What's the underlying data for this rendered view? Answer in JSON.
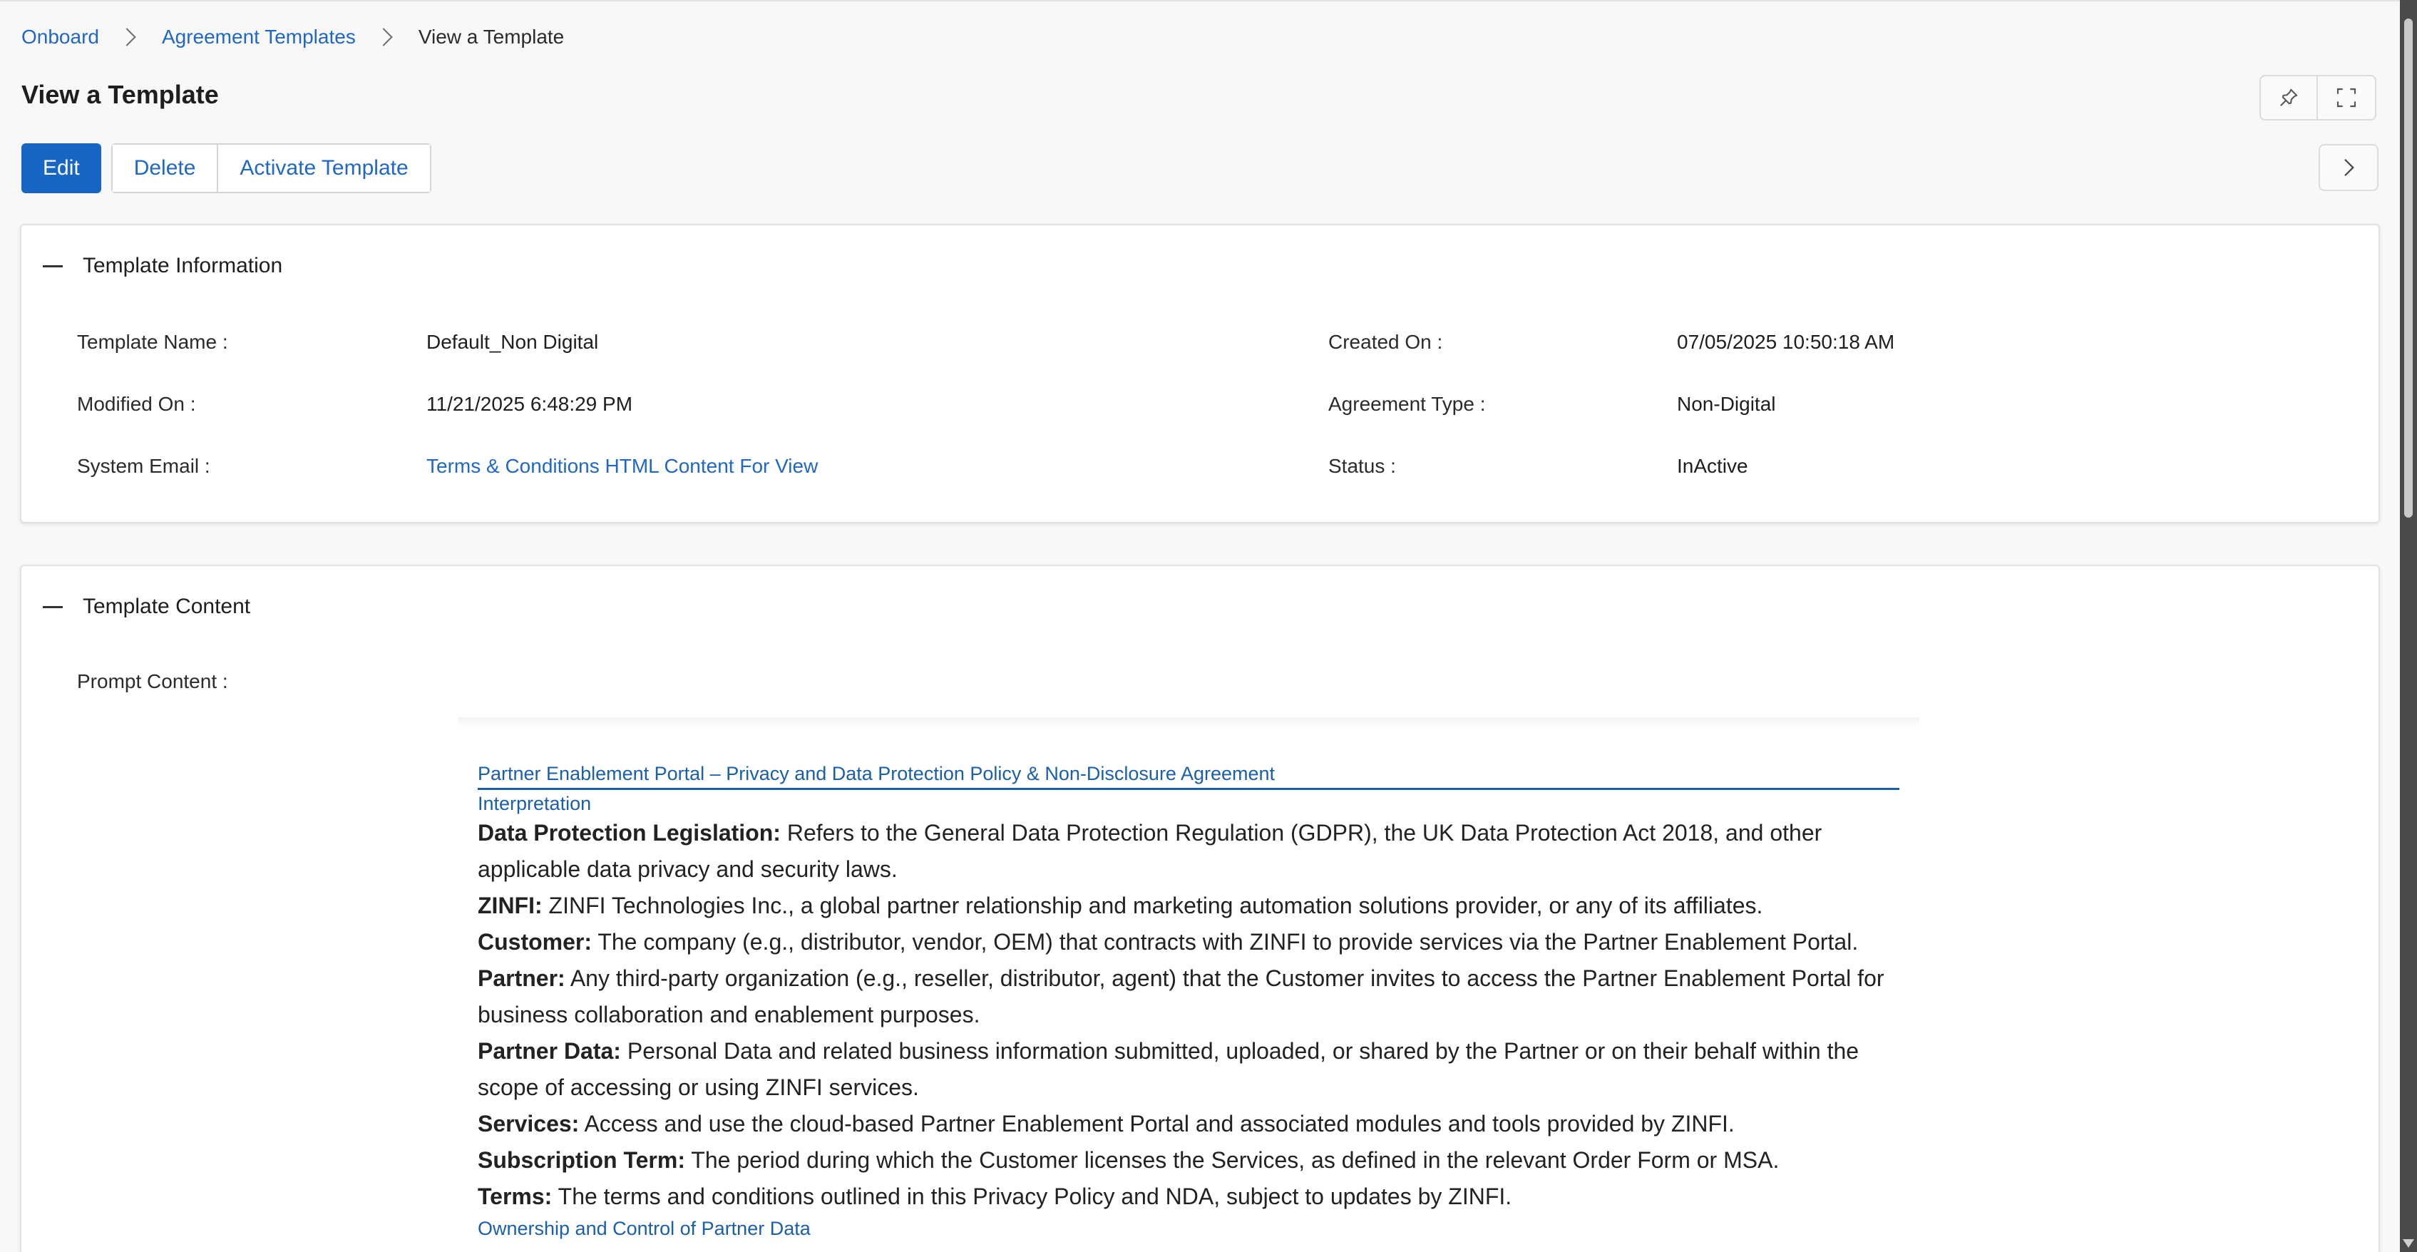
{
  "breadcrumb": {
    "items": [
      "Onboard",
      "Agreement Templates"
    ],
    "current": "View a Template"
  },
  "page": {
    "title": "View a Template"
  },
  "actions": {
    "edit": "Edit",
    "delete": "Delete",
    "activate": "Activate Template"
  },
  "icons": {
    "pin": "pin-icon",
    "expand": "fullscreen-icon",
    "next": "chevron-right-icon",
    "collapse": "minus-icon"
  },
  "template_info": {
    "title": "Template Information",
    "template_name_label": "Template Name :",
    "template_name": "Default_Non Digital",
    "created_on_label": "Created On :",
    "created_on": "07/05/2025 10:50:18 AM",
    "modified_on_label": "Modified On :",
    "modified_on": "11/21/2025 6:48:29 PM",
    "agreement_type_label": "Agreement Type :",
    "agreement_type": "Non-Digital",
    "system_email_label": "System Email :",
    "system_email": "Terms & Conditions HTML Content For View",
    "status_label": "Status :",
    "status": "InActive"
  },
  "template_content": {
    "title": "Template Content",
    "prompt_label": "Prompt Content :",
    "doc_heading": "Partner Enablement Portal – Privacy and Data Protection Policy & Non-Disclosure Agreement",
    "interpretation_heading": "Interpretation",
    "definitions": [
      {
        "term": "Data Protection Legislation:",
        "text": " Refers to the General Data Protection Regulation (GDPR), the UK Data Protection Act 2018, and other applicable data privacy and security laws."
      },
      {
        "term": "ZINFI:",
        "text": " ZINFI Technologies Inc., a global partner relationship and marketing automation solutions provider, or any of its affiliates."
      },
      {
        "term": "Customer:",
        "text": " The company (e.g., distributor, vendor, OEM) that contracts with ZINFI to provide services via the Partner Enablement Portal."
      },
      {
        "term": "Partner:",
        "text": " Any third-party organization (e.g., reseller, distributor, agent) that the Customer invites to access the Partner Enablement Portal for business collaboration and enablement purposes."
      },
      {
        "term": "Partner Data:",
        "text": " Personal Data and related business information submitted, uploaded, or shared by the Partner or on their behalf within the scope of accessing or using ZINFI services."
      },
      {
        "term": "Services:",
        "text": " Access and use the cloud-based Partner Enablement Portal and associated modules and tools provided by ZINFI."
      },
      {
        "term": "Subscription Term:",
        "text": " The period during which the Customer licenses the Services, as defined in the relevant Order Form or MSA."
      },
      {
        "term": "Terms:",
        "text": " The terms and conditions outlined in this Privacy Policy and NDA, subject to updates by ZINFI."
      }
    ],
    "ownership_heading": "Ownership and Control of Partner Data"
  }
}
